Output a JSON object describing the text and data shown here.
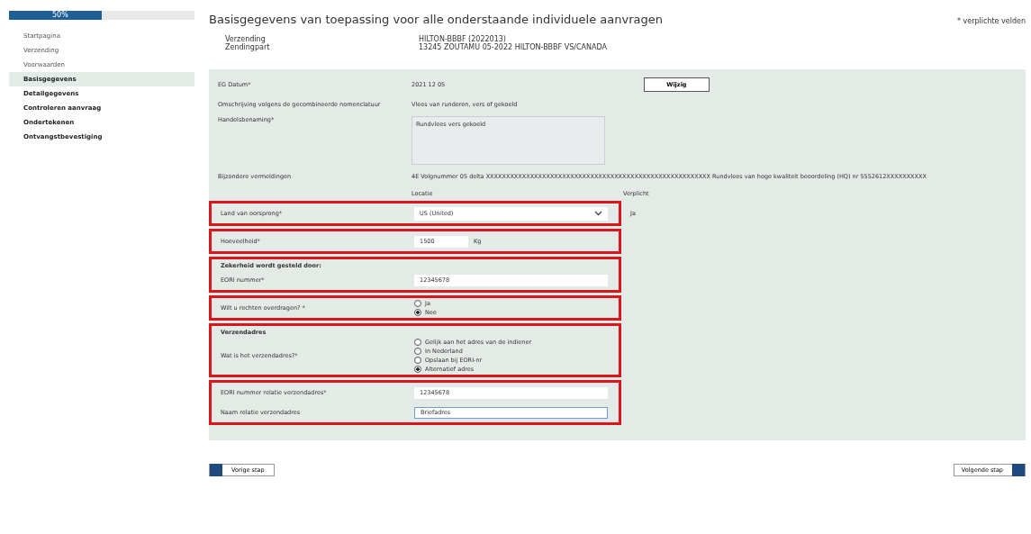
{
  "sidebar": {
    "progress": {
      "label": "50%",
      "level": 0.5
    },
    "items": [
      {
        "label": "Startpagina",
        "selected": false,
        "done": true
      },
      {
        "label": "Verzending",
        "selected": false,
        "done": true
      },
      {
        "label": "Voorwaarden",
        "selected": false,
        "done": true
      },
      {
        "label": "Basisgegevens",
        "selected": true,
        "done": false
      },
      {
        "label": "Detailgegevens",
        "selected": false,
        "done": false
      },
      {
        "label": "Controleren aanvraag",
        "selected": false,
        "done": false
      },
      {
        "label": "Ondertekenen",
        "selected": false,
        "done": false
      },
      {
        "label": "Ontvangstbevestiging",
        "selected": false,
        "done": false
      }
    ]
  },
  "title": "Basisgegevens van toepassing voor alle onderstaande individuele aanvragen",
  "required_note": "* verplichte velden",
  "summary": [
    {
      "label": "Verzending",
      "value": "HILTON-BBBF (2022013)"
    },
    {
      "label": "Zendingpart",
      "value": "13245 ZOUTAMU 05-2022 HILTON-BBBF VS/CANADA"
    }
  ],
  "sections": [
    {
      "highlighted": false,
      "rows": [
        {
          "kind": "text",
          "label": "EG Datum*",
          "value": "2021 12 05",
          "button": "Wijzig"
        },
        {
          "kind": "text",
          "label": "Omschrijving volgens de gecombineerde nomenclatuur",
          "value": "Vlees van runderen, vers of gekoeld"
        },
        {
          "kind": "textarea",
          "label": "Handelsbenaming*",
          "value": "Rundvlees vers gekoeld"
        },
        {
          "kind": "text",
          "label": "Bijzondere vermeldingen",
          "value": "4E Volgnummer 05 delta XXXXXXXXXXXXXXXXXXXXXXXXXXXXXXXXXXXXXXXXXXXXXXXXXXXXXXXX Rundvlees van hoge kwaliteit beoordeling (HQ) nr 5552612XXXXXXXXXX"
        },
        {
          "kind": "columns",
          "label": "Locatie",
          "value": "Verplicht"
        }
      ]
    },
    {
      "highlighted": true,
      "rows": [
        {
          "kind": "select",
          "label": "Land van oorsprong*",
          "value": "US (United)",
          "side": "Ja"
        }
      ]
    },
    {
      "highlighted": true,
      "rows": [
        {
          "kind": "quantity",
          "label": "Hoeveelheid*",
          "value": "1500",
          "unit": "Kg"
        }
      ]
    },
    {
      "highlighted": true,
      "rows": [
        {
          "kind": "heading",
          "label": "Zekerheid wordt gesteld door:"
        },
        {
          "kind": "input",
          "label": "EORI nummer*",
          "value": "12345678",
          "focused": false
        }
      ]
    },
    {
      "highlighted": true,
      "rows": [
        {
          "kind": "radio",
          "label": "Wilt u rechten overdragen? *",
          "options": [
            {
              "label": "Ja",
              "selected": false
            },
            {
              "label": "Nee",
              "selected": true
            }
          ]
        }
      ]
    },
    {
      "highlighted": true,
      "rows": [
        {
          "kind": "heading",
          "label": "Verzendadres"
        },
        {
          "kind": "radio",
          "label": "Wat is het verzendadres?*",
          "options": [
            {
              "label": "Gelijk aan het adres van de indiener",
              "selected": false
            },
            {
              "label": "In Nederland",
              "selected": false
            },
            {
              "label": "Opslaan bij EORI-nr",
              "selected": false
            },
            {
              "label": "Alternatief adres",
              "selected": true
            }
          ]
        }
      ]
    },
    {
      "highlighted": true,
      "rows": [
        {
          "kind": "input",
          "label": "EORI nummer relatie verzendadres*",
          "value": "12345678",
          "focused": false
        },
        {
          "kind": "input",
          "label": "Naam relatie verzendadres",
          "value": "Briefadres",
          "focused": true
        }
      ]
    }
  ],
  "buttons": {
    "previous": "Vorige stap",
    "next": "Volgende stap"
  }
}
